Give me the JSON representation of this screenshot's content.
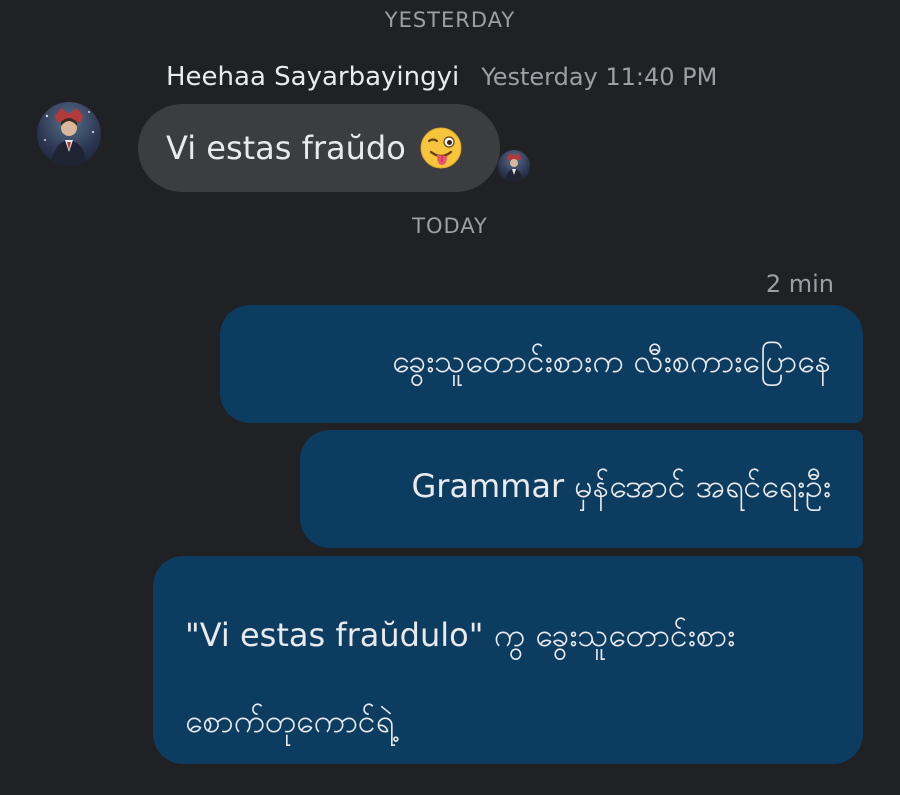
{
  "separators": {
    "yesterday": "YESTERDAY",
    "today": "TODAY"
  },
  "incoming": {
    "sender": "Heehaa Sayarbayingyi",
    "timestamp": "Yesterday 11:40 PM",
    "text": "Vi estas fraŭdo",
    "emoji_icon": "winking-face-with-tongue-icon"
  },
  "outgoing": {
    "timestamp": "2 min",
    "messages": [
      {
        "text": "ခွေးသူတောင်းစားက လီးစကားပြောနေ"
      },
      {
        "text": "Grammar မှန်အောင် အရင်ရေးဦး"
      },
      {
        "lines": [
          "\"Vi estas fraŭdulo\" ကွ ခွေးသူတောင်းစား",
          "စောက်တုကောင်ရဲ့"
        ]
      }
    ]
  },
  "colors": {
    "background": "#202124",
    "incoming_bubble": "#3c3d40",
    "outgoing_bubble": "#0d3c61",
    "secondary_text": "#9aa0a6",
    "primary_text": "#e8eaed"
  }
}
